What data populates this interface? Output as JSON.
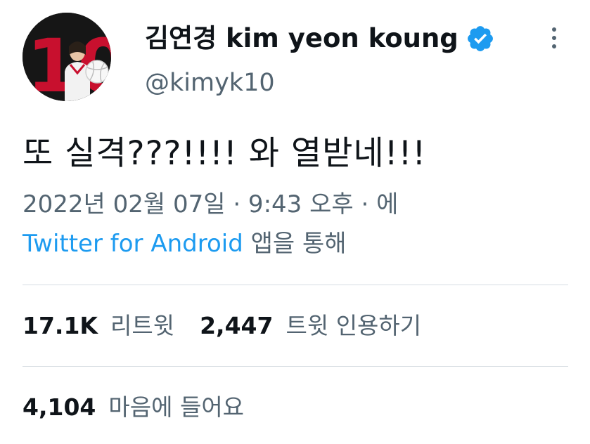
{
  "user": {
    "display_name": "김연경 kim yeon koung",
    "handle": "@kimyk10",
    "verified": true,
    "avatar_jersey_number": "10"
  },
  "tweet": {
    "text": "또 실격???!!!! 와 열받네!!!",
    "timestamp": "2022년 02월 07일 · 9:43 오후 · 에",
    "source_app": "Twitter for Android",
    "source_suffix": " 앱을 통해"
  },
  "stats": {
    "retweets_count": "17.1K",
    "retweets_label": "리트윗",
    "quotes_count": "2,447",
    "quotes_label": "트윗 인용하기",
    "likes_count": "4,104",
    "likes_label": "마음에 들어요"
  },
  "colors": {
    "text_primary": "#0f1419",
    "text_secondary": "#536471",
    "link": "#1d9bf0",
    "verified_badge": "#1d9bf0",
    "divider": "#d6dde2"
  },
  "icons": {
    "verified": "verified-badge-icon",
    "more": "more-options-icon"
  }
}
